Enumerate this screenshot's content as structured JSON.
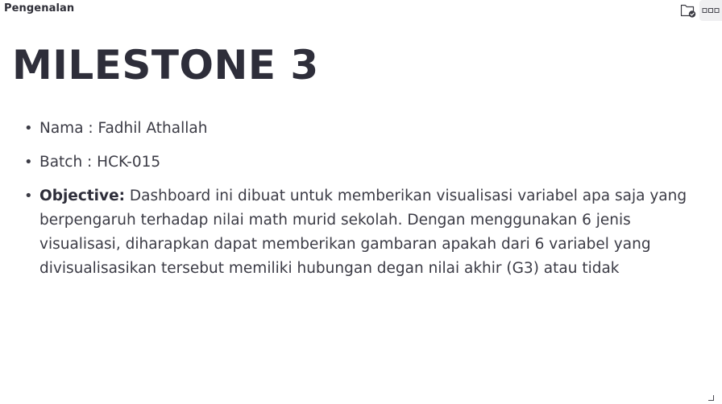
{
  "header": {
    "breadcrumb": "Pengenalan",
    "folder_icon": "folder-check-icon",
    "more_icon": "more-dots-icon"
  },
  "main": {
    "title": "MILESTONE 3",
    "items": [
      {
        "label": "",
        "text": "Nama : Fadhil Athallah"
      },
      {
        "label": "",
        "text": "Batch : HCK-015"
      },
      {
        "label": "Objective:",
        "text": " Dashboard ini dibuat untuk memberikan visualisasi variabel apa saja yang berpengaruh terhadap nilai math murid sekolah. Dengan menggunakan 6 jenis visualisasi, diharapkan dapat memberikan gambaran apakah dari 6 variabel yang divisualisasikan tersebut memiliki hubungan degan nilai akhir (G3) atau tidak"
      }
    ]
  },
  "colors": {
    "text": "#3b3b45",
    "title": "#2e2e3a",
    "button_bg": "#efeff1"
  }
}
